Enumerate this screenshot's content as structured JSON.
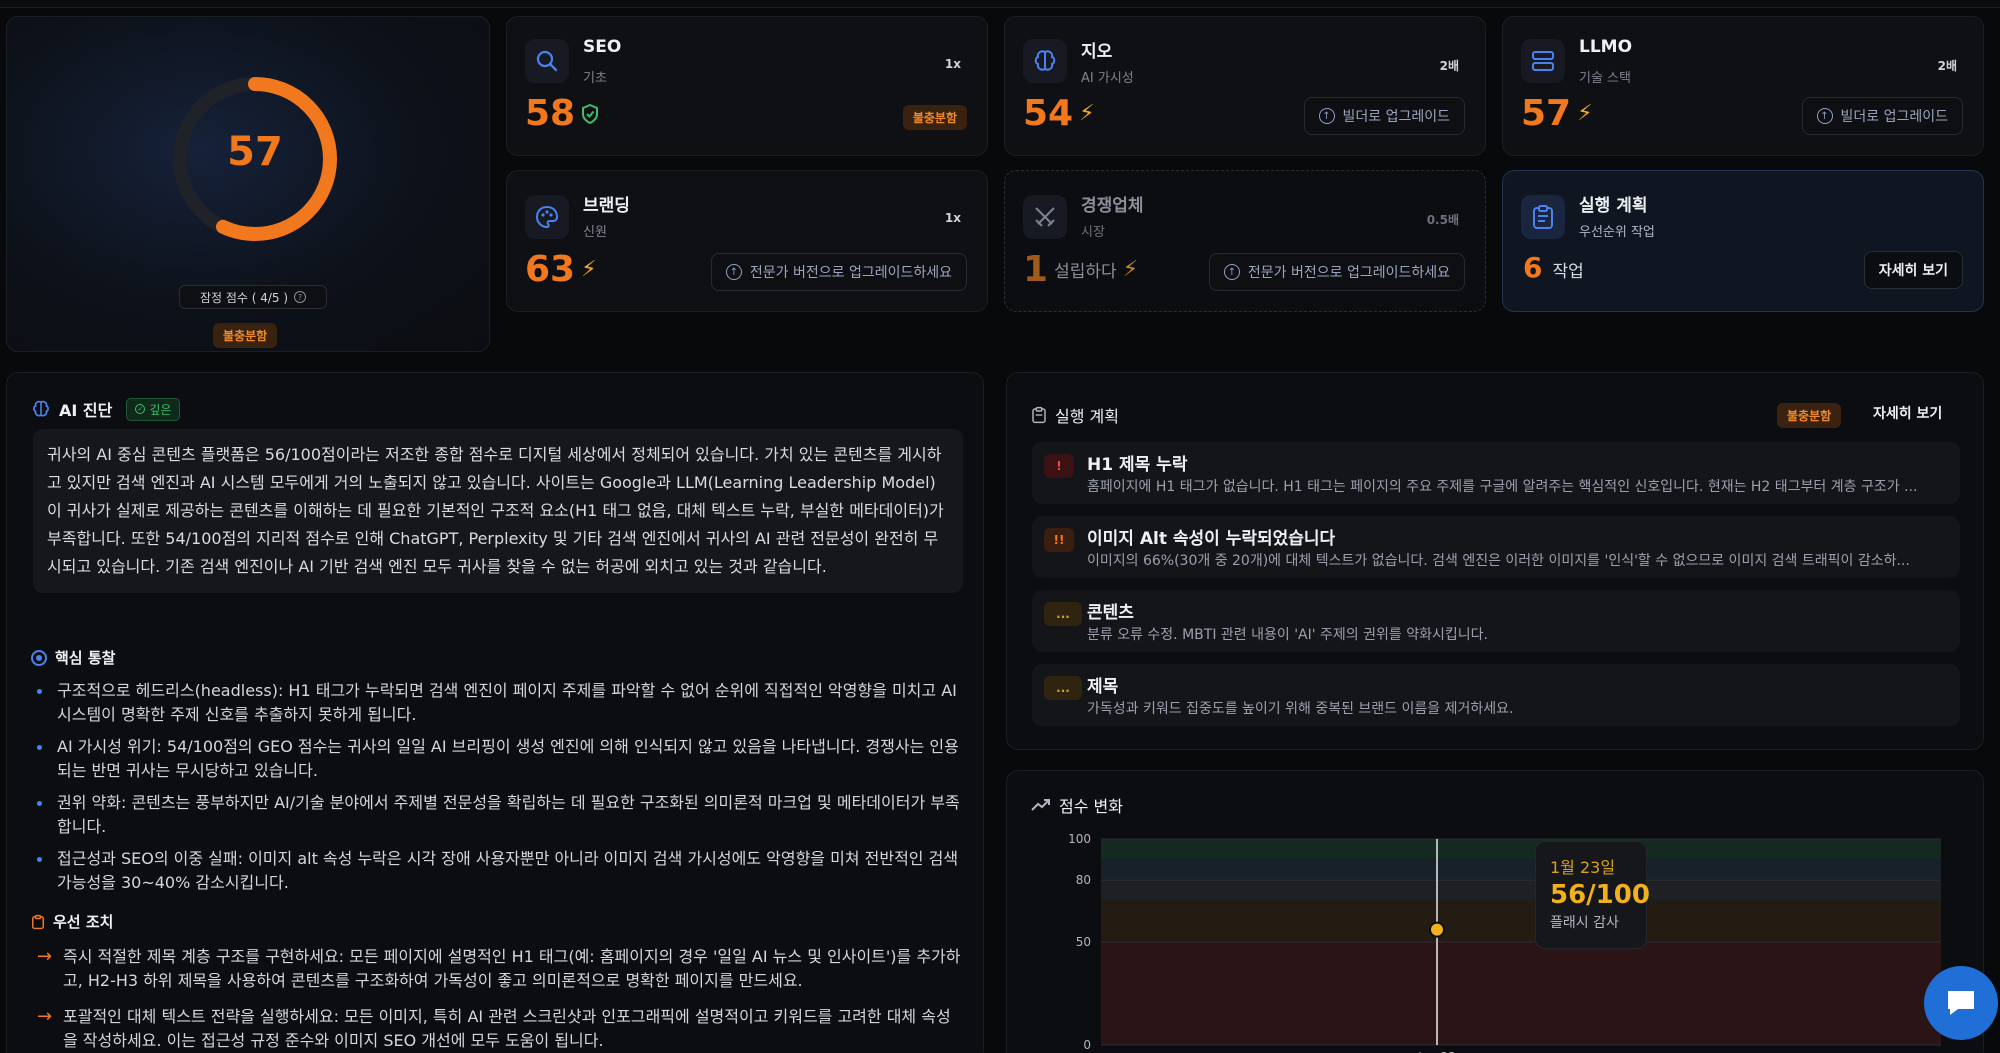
{
  "gauge": {
    "score": "57",
    "label": "잠정 점수 ( 4/5 )",
    "status": "불충분함",
    "fraction": 0.57
  },
  "cards": [
    {
      "title": "SEO",
      "sub": "기초",
      "mult": "1x",
      "score": "58",
      "badge": "불충분함",
      "icon": "search-icon"
    },
    {
      "title": "지오",
      "sub": "AI 가시성",
      "mult": "2배",
      "score": "54",
      "button": "빌더로 업그레이드",
      "icon": "brain-icon"
    },
    {
      "title": "LLMO",
      "sub": "기술 스택",
      "mult": "2배",
      "score": "57",
      "button": "빌더로 업그레이드",
      "icon": "server-icon"
    },
    {
      "title": "브랜딩",
      "sub": "신원",
      "mult": "1x",
      "score": "63",
      "button": "전문가 버전으로 업그레이드하세요",
      "icon": "palette-icon"
    },
    {
      "title": "경쟁업체",
      "sub": "시장",
      "mult": "0.5배",
      "score": "1",
      "score_suffix": "설립하다",
      "button": "전문가 버전으로 업그레이드하세요",
      "icon": "swords-icon"
    }
  ],
  "action_card": {
    "title": "실행 계획",
    "sub": "우선순위 작업",
    "count": "6",
    "count_label": "작업",
    "button": "자세히 보기"
  },
  "diagnosis": {
    "title": "AI 진단",
    "badge": "깊은",
    "summary": "귀사의 AI 중심 콘텐츠 플랫폼은 56/100점이라는 저조한 종합 점수로 디지털 세상에서 정체되어 있습니다. 가치 있는 콘텐츠를 게시하고 있지만 검색 엔진과 AI 시스템 모두에게 거의 노출되지 않고 있습니다. 사이트는 Google과 LLM(Learning Leadership Model)이 귀사가 실제로 제공하는 콘텐츠를 이해하는 데 필요한 기본적인 구조적 요소(H1 태그 없음, 대체 텍스트 누락, 부실한 메타데이터)가 부족합니다. 또한 54/100점의 지리적 점수로 인해 ChatGPT, Perplexity 및 기타 검색 엔진에서 귀사의 AI 관련 전문성이 완전히 무시되고 있습니다. 기존 검색 엔진이나 AI 기반 검색 엔진 모두 귀사를 찾을 수 없는 허공에 외치고 있는 것과 같습니다.",
    "insights_title": "핵심 통찰",
    "insights": [
      "구조적으로 헤드리스(headless): H1 태그가 누락되면 검색 엔진이 페이지 주제를 파악할 수 없어 순위에 직접적인 악영향을 미치고 AI 시스템이 명확한 주제 신호를 추출하지 못하게 됩니다.",
      "AI 가시성 위기: 54/100점의 GEO 점수는 귀사의 일일 AI 브리핑이 생성 엔진에 의해 인식되지 않고 있음을 나타냅니다. 경쟁사는 인용되는 반면 귀사는 무시당하고 있습니다.",
      "권위 약화: 콘텐츠는 풍부하지만 AI/기술 분야에서 주제별 전문성을 확립하는 데 필요한 구조화된 의미론적 마크업 및 메타데이터가 부족합니다.",
      "접근성과 SEO의 이중 실패: 이미지 alt 속성 누락은 시각 장애 사용자뿐만 아니라 이미지 검색 가시성에도 악영향을 미쳐 전반적인 검색 가능성을 30~40% 감소시킵니다."
    ],
    "actions_title": "우선 조치",
    "actions": [
      "즉시 적절한 제목 계층 구조를 구현하세요: 모든 페이지에 설명적인 H1 태그(예: 홈페이지의 경우 '일일 AI 뉴스 및 인사이트')를 추가하고, H2-H3 하위 제목을 사용하여 콘텐츠를 구조화하여 가독성이 좋고 의미론적으로 명확한 페이지를 만드세요.",
      "포괄적인 대체 텍스트 전략을 실행하세요: 모든 이미지, 특히 AI 관련 스크린샷과 인포그래픽에 설명적이고 키워드를 고려한 대체 속성을 작성하세요. 이는 접근성 규정 준수와 이미지 SEO 개선에 모두 도움이 됩니다."
    ]
  },
  "plan": {
    "title": "실행 계획",
    "badge": "불충분함",
    "button": "자세히 보기",
    "items": [
      {
        "icon": "!",
        "title": "H1 제목 누락",
        "desc": "홈페이지에 H1 태그가 없습니다. H1 태그는 페이지의 주요 주제를 구글에 알려주는 핵심적인 신호입니다. 현재는 H2 태그부터 계층 구조가 ..."
      },
      {
        "icon": "!!",
        "title": "이미지 Alt 속성이 누락되었습니다",
        "desc": "이미지의 66%(30개 중 20개)에 대체 텍스트가 없습니다. 검색 엔진은 이러한 이미지를 '인식'할 수 없으므로 이미지 검색 트래픽이 감소하..."
      },
      {
        "icon": "...",
        "title": "콘텐츠",
        "desc": "분류 오류 수정. MBTI 관련 내용이 'AI' 주제의 권위를 약화시킵니다."
      },
      {
        "icon": "...",
        "title": "제목",
        "desc": "가독성과 키워드 집중도를 높이기 위해 중복된 브랜드 이름을 제거하세요."
      }
    ]
  },
  "chart_data": {
    "type": "line",
    "title": "점수 변화",
    "x": [
      "Jan 23"
    ],
    "series": [
      {
        "values": [
          56
        ]
      }
    ],
    "ylim": [
      0,
      100
    ],
    "yticks": [
      "100",
      "80",
      "50",
      "0"
    ],
    "bands": [
      {
        "from": 0,
        "to": 50,
        "color": "#2a1416"
      },
      {
        "from": 50,
        "to": 70,
        "color": "#241c12"
      },
      {
        "from": 70,
        "to": 80,
        "color": "#1e2024"
      },
      {
        "from": 80,
        "to": 90,
        "color": "#18202a"
      },
      {
        "from": 90,
        "to": 100,
        "color": "#14291f"
      }
    ],
    "tooltip": {
      "date": "1월 23일",
      "value": "56/100",
      "label": "플래시 감사"
    }
  },
  "colors": {
    "accent": "#f2781d",
    "blue": "#4a82f0",
    "green": "#3fbf6a"
  }
}
